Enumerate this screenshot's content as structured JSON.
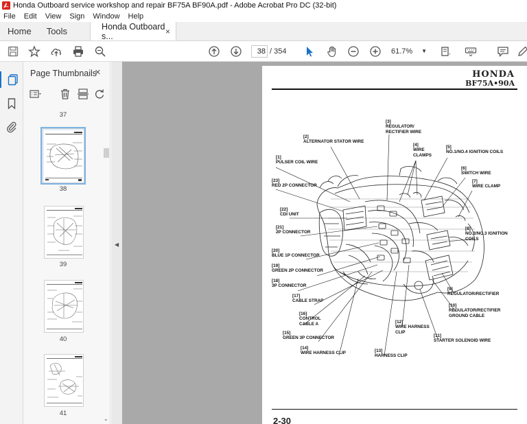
{
  "window": {
    "title": "Honda Outboard service workshop and repair BF75A BF90A.pdf - Adobe Acrobat Pro DC (32-bit)"
  },
  "menu": [
    "File",
    "Edit",
    "View",
    "Sign",
    "Window",
    "Help"
  ],
  "tabs": {
    "home": "Home",
    "tools": "Tools",
    "document": "Honda Outboard s...",
    "close": "×"
  },
  "toolbar": {
    "current_page": "38",
    "total_pages": "/ 354",
    "zoom": "61.7%"
  },
  "sidebar": {
    "title": "Page Thumbnails",
    "close": "×",
    "pages": [
      "37",
      "38",
      "39",
      "40",
      "41"
    ],
    "selected_page": "38"
  },
  "document": {
    "brand": "HONDA",
    "model": "BF75A•90A",
    "page_number": "2-30",
    "labels": [
      "[3]\nREGULATOR/\nRECTIFIER WIRE",
      "[2]\nALTERNATOR STATOR WIRE",
      "[4]\nWIRE\nCLAMPS",
      "[5]\nNO.1/NO.4 IGNITION COILS",
      "[1]\nPULSER COIL WIRE",
      "[6]\nSWITCH WIRE",
      "[23]\nRED 2P CONNECTOR",
      "[7]\nWIRE CLAMP",
      "[22]\nCDI UNIT",
      "[21]\n2P CONNECTOR",
      "[8]\nNO.2/NO.3 IGNITION\nCOILS",
      "[20]\nBLUE 1P CONNECTOR",
      "[19]\nGREEN 2P CONNECTOR",
      "[18]\n3P CONNECTOR",
      "[9]\nREGULATOR/RECTIFIER",
      "[17]\nCABLE STRAP",
      "[10]\nREGULATOR/RECTIFIER\nGROUND CABLE",
      "[16]\nCONTROL\nCABLE A",
      "[12]\nWIRE HARNESS\nCLIP",
      "[15]\nGREEN 3P CONNECTOR",
      "[11]\nSTARTER SOLENOID WIRE",
      "[14]\nWIRE HARNESS CLIP",
      "[13]\nHARNESS CLIP"
    ]
  },
  "colors": {
    "accent": "#1a73c8",
    "pdf_red": "#d8261c",
    "doc_bg": "#a9a9a9"
  }
}
